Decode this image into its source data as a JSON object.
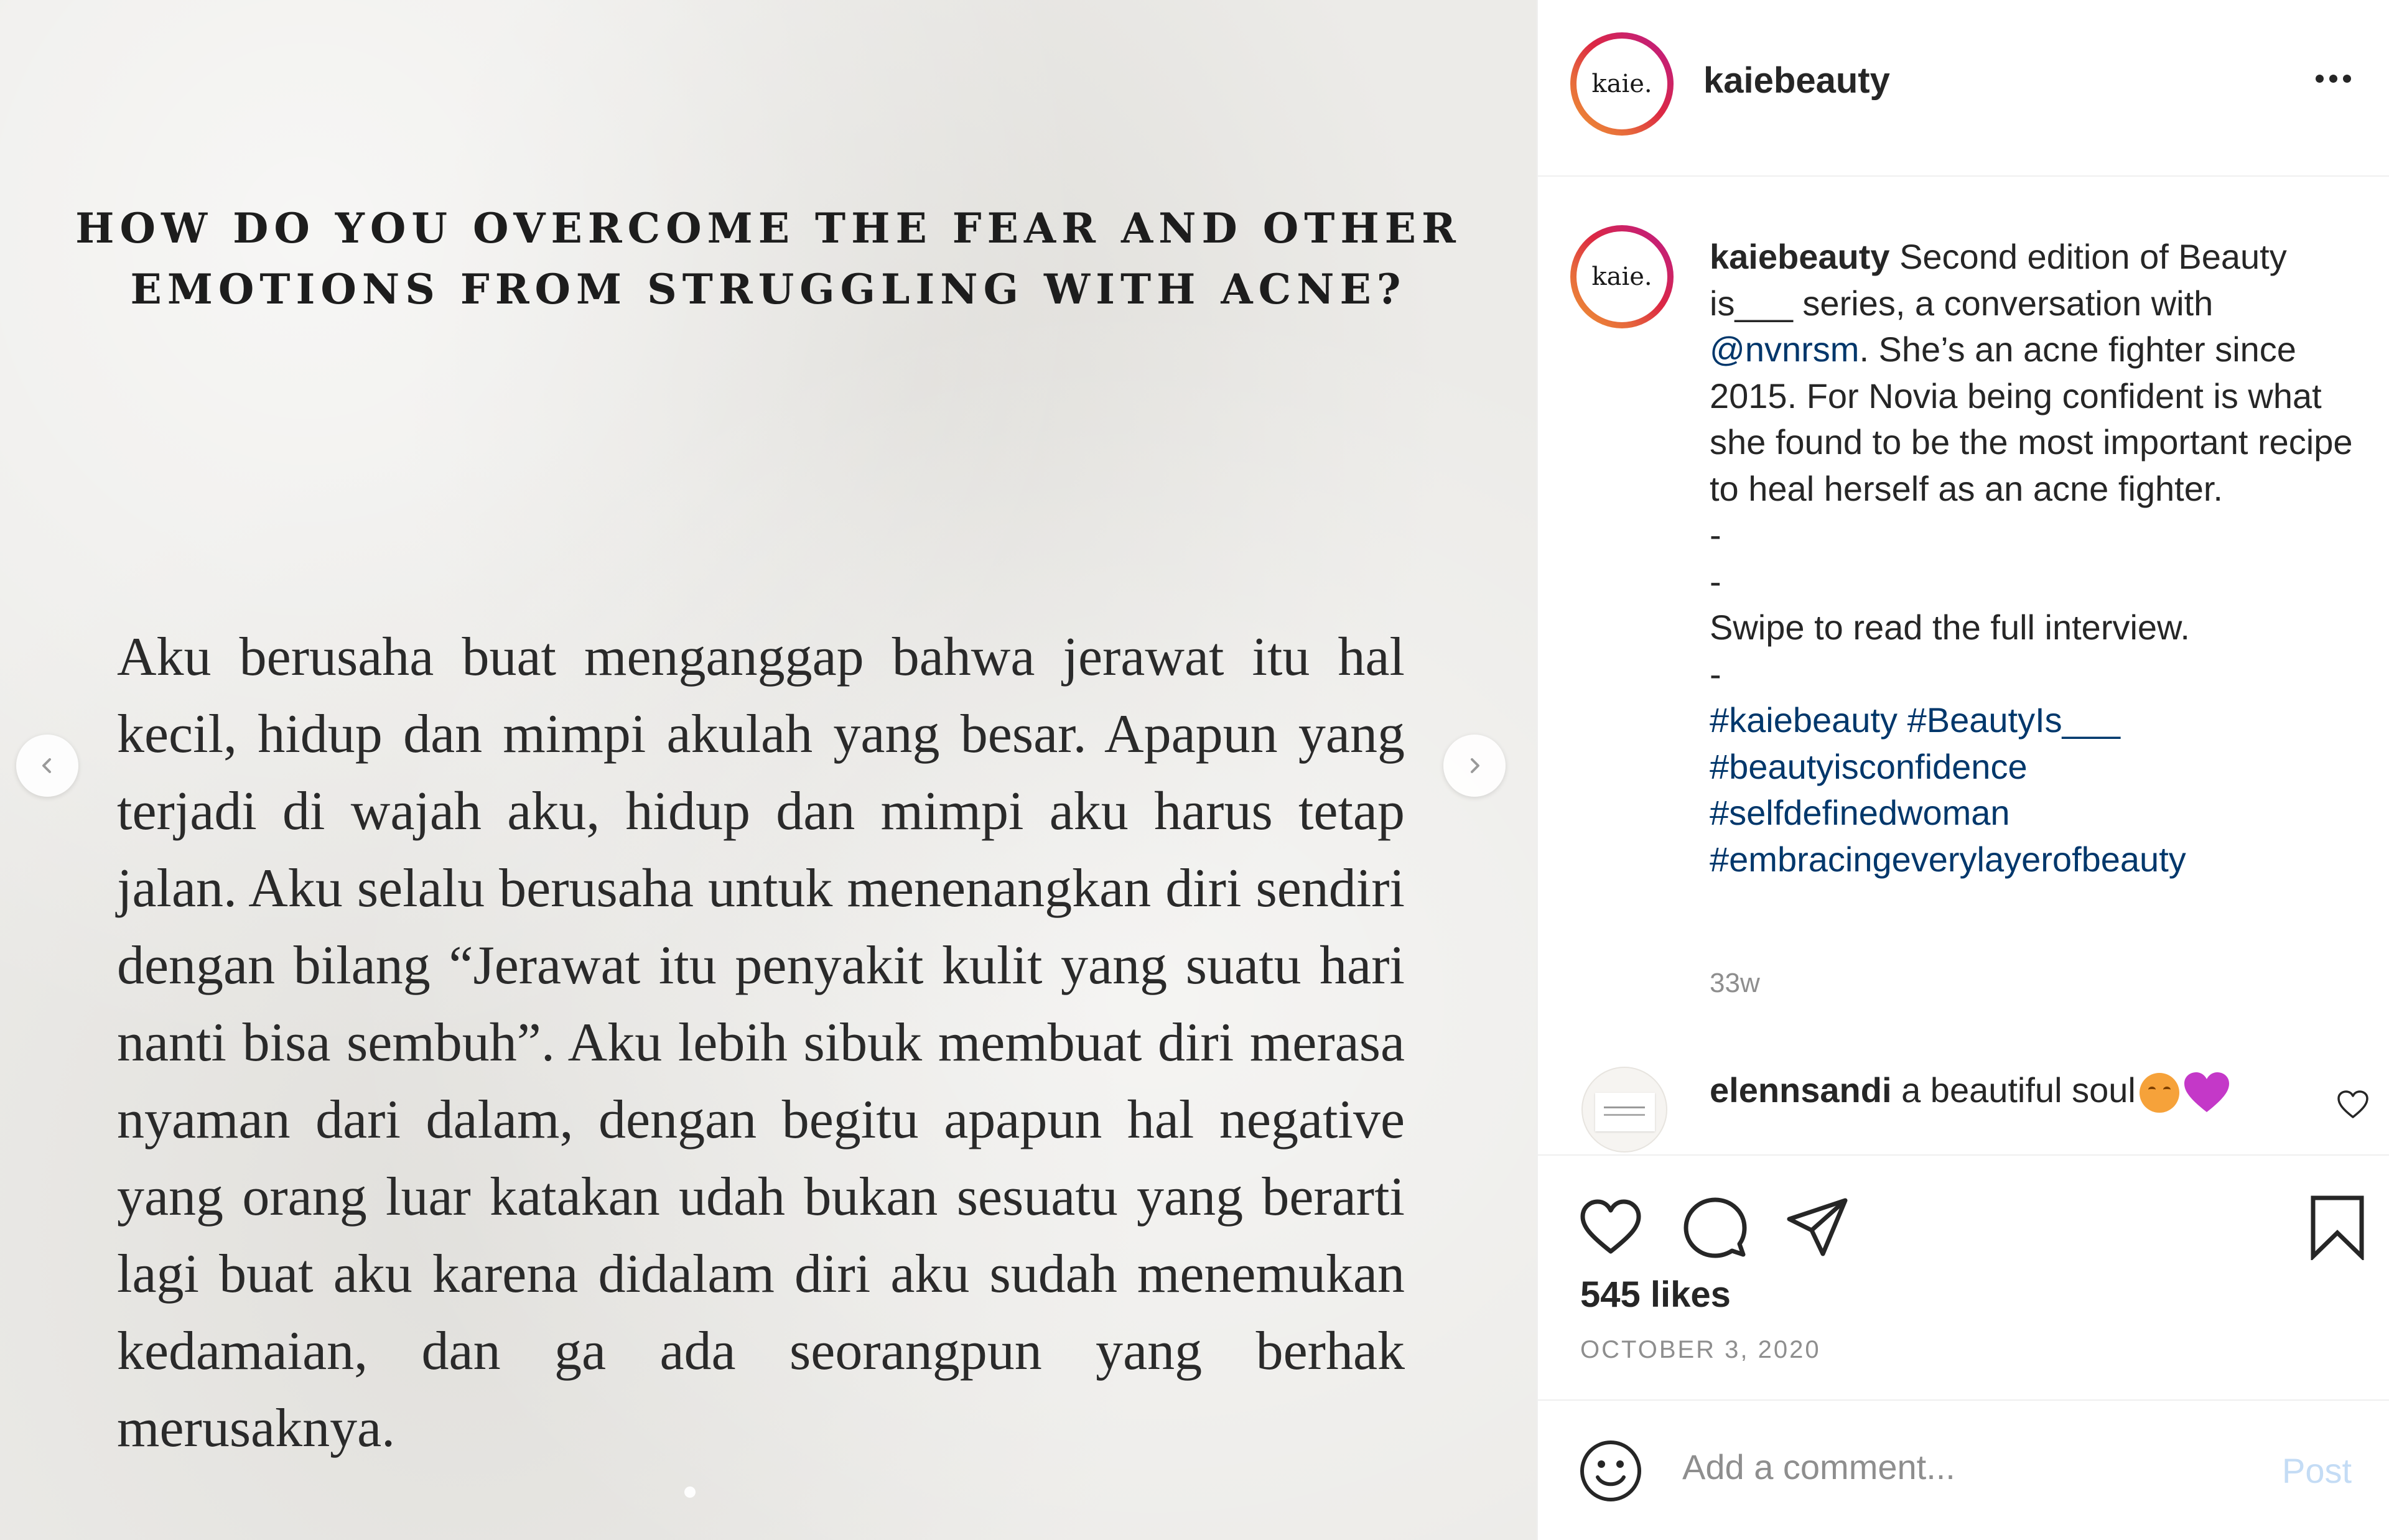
{
  "image": {
    "question_lines": [
      "HOW DO YOU OVERCOME THE FEAR AND OTHER",
      "EMOTIONS FROM STRUGGLING WITH ACNE?"
    ],
    "answer": "Aku berusaha buat menganggap bahwa jerawat itu hal kecil, hidup dan mimpi akulah yang besar. Apapun yang terjadi di wajah aku, hidup dan mimpi aku harus tetap jalan. Aku selalu berusaha untuk menenangkan diri sendiri dengan bilang “Jerawat itu penyakit kulit yang suatu hari nanti bisa sembuh”. Aku lebih sibuk membuat diri merasa nyaman dari dalam, dengan begitu apapun hal negative yang orang luar katakan udah bukan sesuatu yang berarti lagi buat aku karena didalam diri aku sudah menemukan kedamaian, dan ga ada seorangpun yang berhak merusaknya.",
    "prev_icon": "chevron-left-icon",
    "next_icon": "chevron-right-icon"
  },
  "header": {
    "avatar_text": "kaie.",
    "username": "kaiebeauty",
    "more_icon": "more-horizontal-icon"
  },
  "caption": {
    "username": "kaiebeauty",
    "text_start": "Second edition of Beauty is___ series, a conversation with",
    "mention": "@nvnrsm",
    "text_after_mention": ". She’s an acne fighter since 2015. For Novia being confident is what she found to be the most important recipe to heal herself as an acne fighter.",
    "dash1": "-",
    "dash2": "-",
    "swipe": "Swipe to read the full interview.",
    "dash3": "-",
    "hashtags": [
      "#kaiebeauty",
      "#BeautyIs___",
      "#beautyisconfidence",
      "#selfdefinedwoman",
      "#embracingeverylayerofbeauty"
    ],
    "time_ago": "33w"
  },
  "comment": {
    "username": "elennsandi",
    "text": "a beautiful soul",
    "emojis": [
      "smiling-face-emoji",
      "purple-heart-emoji"
    ]
  },
  "actions": {
    "like_icon": "heart-icon",
    "comment_icon": "comment-bubble-icon",
    "share_icon": "paper-plane-icon",
    "save_icon": "bookmark-icon"
  },
  "likes": "545 likes",
  "date": "OCTOBER 3, 2020",
  "add_comment": {
    "placeholder": "Add a comment...",
    "post_label": "Post"
  },
  "colors": {
    "link": "#00376b",
    "muted": "#8e8e8e",
    "post_disabled": "#c4dcf5",
    "image_background": "#ecebe8"
  }
}
